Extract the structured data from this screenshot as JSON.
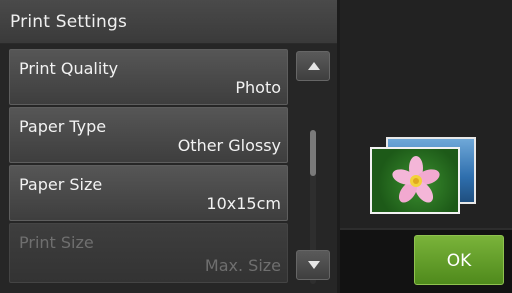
{
  "header": {
    "title": "Print Settings"
  },
  "settings": [
    {
      "name": "Print Quality",
      "value": "Photo",
      "enabled": true
    },
    {
      "name": "Paper Type",
      "value": "Other Glossy",
      "enabled": true
    },
    {
      "name": "Paper Size",
      "value": "10x15cm",
      "enabled": true
    },
    {
      "name": "Print Size",
      "value": "Max. Size",
      "enabled": false
    }
  ],
  "scroll": {
    "up_icon": "chevron-up-icon",
    "down_icon": "chevron-down-icon"
  },
  "preview": {
    "icon": "photo-preview-icon"
  },
  "actions": {
    "ok_label": "OK"
  },
  "colors": {
    "ok_button": "#5f9c25",
    "background": "#1c1c1c"
  }
}
